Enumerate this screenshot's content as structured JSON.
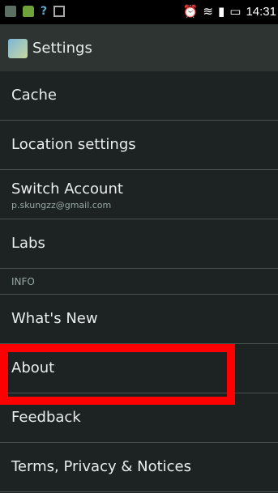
{
  "header": {
    "title": "Settings"
  },
  "status_bar": {
    "time": "14:31"
  },
  "settings": {
    "items": [
      {
        "label": "Cache"
      },
      {
        "label": "Location settings"
      },
      {
        "label": "Switch Account",
        "sublabel": "p.skungzz@gmail.com"
      },
      {
        "label": "Labs"
      }
    ],
    "section_info": "INFO",
    "info_items": [
      {
        "label": "What's New"
      },
      {
        "label": "About"
      },
      {
        "label": "Feedback"
      },
      {
        "label": "Terms, Privacy & Notices"
      }
    ]
  },
  "colors": {
    "highlight": "#ff0000",
    "background": "#1c2322"
  }
}
